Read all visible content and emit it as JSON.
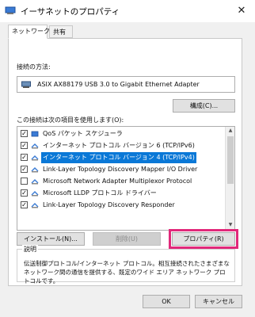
{
  "window": {
    "title": "イーサネットのプロパティ",
    "close_glyph": "✕"
  },
  "tabs": [
    {
      "label": "ネットワーク"
    },
    {
      "label": "共有"
    }
  ],
  "connection": {
    "label": "接続の方法:",
    "adapter_name": "ASIX AX88179 USB 3.0 to Gigabit Ethernet Adapter",
    "configure_button": "構成(C)..."
  },
  "items_section": {
    "label": "この接続は次の項目を使用します(O):",
    "items": [
      {
        "label": "QoS パケット スケジューラ",
        "checked": true,
        "icon": "network-service-icon"
      },
      {
        "label": "インターネット プロトコル バージョン 6 (TCP/IPv6)",
        "checked": true,
        "icon": "protocol-icon"
      },
      {
        "label": "インターネット プロトコル バージョン 4 (TCP/IPv4)",
        "checked": true,
        "icon": "protocol-icon",
        "selected": true
      },
      {
        "label": "Link-Layer Topology Discovery Mapper I/O Driver",
        "checked": true,
        "icon": "protocol-icon"
      },
      {
        "label": "Microsoft Network Adapter Multiplexor Protocol",
        "checked": false,
        "icon": "protocol-icon"
      },
      {
        "label": "Microsoft LLDP プロトコル ドライバー",
        "checked": true,
        "icon": "protocol-icon"
      },
      {
        "label": "Link-Layer Topology Discovery Responder",
        "checked": true,
        "icon": "protocol-icon"
      }
    ]
  },
  "buttons": {
    "install": "インストール(N)...",
    "uninstall": "削除(U)",
    "properties": "プロパティ(R)",
    "ok": "OK",
    "cancel": "キャンセル"
  },
  "description": {
    "legend": "説明",
    "text": "伝送制御プロトコル/インターネット プロトコル。相互接続されたさまざまなネットワーク間の通信を提供する、既定のワイド エリア ネットワーク プロトコルです。"
  },
  "colors": {
    "selection": "#0a78d7",
    "highlight_outline": "#e1287a"
  }
}
